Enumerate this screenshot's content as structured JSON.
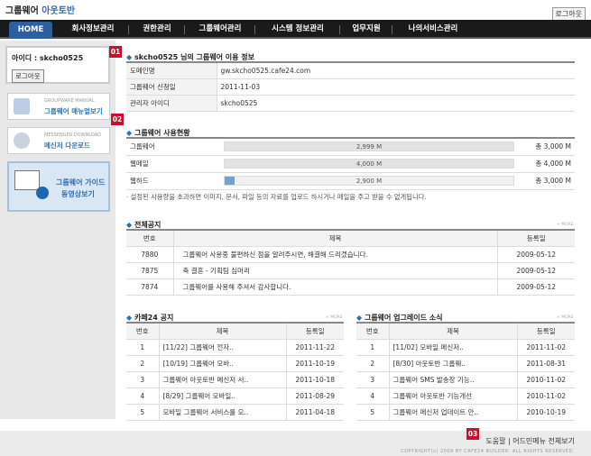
{
  "header": {
    "logo_main": "그룹웨어",
    "logo_accent": "아웃토반",
    "logout": "로그아웃"
  },
  "nav": {
    "items": [
      "HOME",
      "회사정보관리",
      "권한관리",
      "그룹웨어관리",
      "시스템 정보관리",
      "업무지원",
      "나의서비스관리"
    ]
  },
  "sidebar": {
    "user_label": "아이디 : skcho0525",
    "logout_button": "로그아웃",
    "manual_small": "GROUPWARE MANUAL",
    "manual_label": "그룹웨어 매뉴얼보기",
    "messenger_small": "MESSENGER DOWNLOAD",
    "messenger_label": "메신저 다운로드",
    "guide_line1": "그룹웨어 가이드",
    "guide_line2": "동영상보기"
  },
  "badges": [
    "01",
    "02",
    "03"
  ],
  "info": {
    "title": "skcho0525 님의 그룹웨어 이용 정보",
    "rows": [
      {
        "label": "도메인명",
        "value": "gw.skcho0525.cafe24.com"
      },
      {
        "label": "그룹웨어 신청일",
        "value": "2011-11-03"
      },
      {
        "label": "관리자 아이디",
        "value": "skcho0525"
      }
    ]
  },
  "usage": {
    "title": "그룹웨어 사용현황",
    "rows": [
      {
        "label": "그룹웨어",
        "used": "2,999 M",
        "total": "총 3,000 M",
        "ratio": 0.9997
      },
      {
        "label": "웹메일",
        "used": "4,000 M",
        "total": "총 4,000 M",
        "ratio": 1.0
      },
      {
        "label": "웹하드",
        "used": "2,900 M",
        "total": "총 3,000 M",
        "ratio": 0.0357
      }
    ],
    "note": "· 설정된 사용량을 초과하면 이미지, 문서, 파일 등의 자료를 업로드 하시거나 메일을 주고 받을 수 없게됩니다."
  },
  "notice": {
    "title": "전체공지",
    "more": "+ MORE",
    "headers": [
      "번호",
      "제목",
      "등록일"
    ],
    "rows": [
      [
        "7880",
        "그룹웨어 사용중 불편하신 점을 알려주시면, 해결해 드리겠습니다.",
        "2009-05-12"
      ],
      [
        "7875",
        "축 결혼 - 기획팀 심머리",
        "2009-05-12"
      ],
      [
        "7874",
        "그룹웨어를 사용해 주셔서 감사합니다.",
        "2009-05-12"
      ]
    ]
  },
  "cafe": {
    "title": "카페24 공지",
    "more": "+ MORE",
    "headers": [
      "번호",
      "제목",
      "등록일"
    ],
    "rows": [
      [
        "1",
        "[11/22] 그룹웨어 전자..",
        "2011-11-22"
      ],
      [
        "2",
        "[10/19] 그룹웨어 모바..",
        "2011-10-19"
      ],
      [
        "3",
        "그룹웨어 아웃토반 메신저 서..",
        "2011-10-18"
      ],
      [
        "4",
        "[8/29] 그룹웨어 모바일..",
        "2011-08-29"
      ],
      [
        "5",
        "모바일 그룹웨어 서비스를 오..",
        "2011-04-18"
      ]
    ]
  },
  "upgrade": {
    "title": "그룹웨어 업그레이드 소식",
    "more": "+ MORE",
    "headers": [
      "번호",
      "제목",
      "등록일"
    ],
    "rows": [
      [
        "1",
        "[11/02] 모바일 메신저..",
        "2011-11-02"
      ],
      [
        "2",
        "[8/30] 아웃토반 그룹웨..",
        "2011-08-31"
      ],
      [
        "3",
        "그룹웨어 SMS 발송창 기능..",
        "2010-11-02"
      ],
      [
        "4",
        "그룹웨어 아웃토반 기능개선",
        "2010-11-02"
      ],
      [
        "5",
        "그룹웨어 메신저 업데이트 안..",
        "2010-10-19"
      ]
    ]
  },
  "footer": {
    "links": "도움말 | 어드민메뉴 전체보기",
    "copyright": "COPYRIGHT(c) 2009 BY CAFE24 BUILDER. ALL RIGHTS RESERVED."
  }
}
